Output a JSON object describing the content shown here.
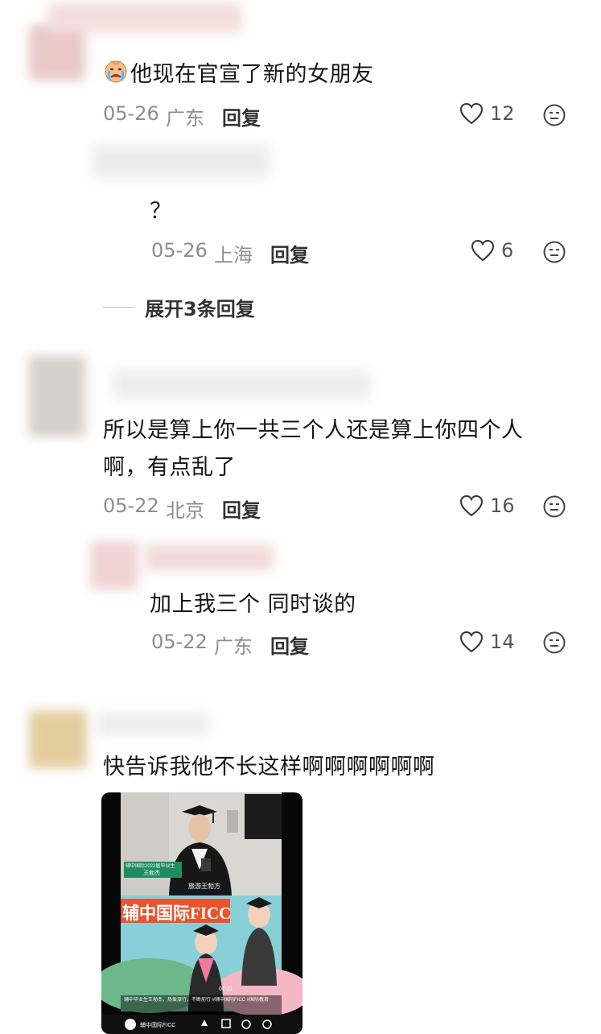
{
  "comments": [
    {
      "text": "他现在官宣了新的女朋友",
      "emoji": "crying-face-icon",
      "date": "05-26",
      "location": "广东",
      "reply_label": "回复",
      "likes": "12"
    },
    {
      "text": "？",
      "date": "05-26",
      "location": "上海",
      "reply_label": "回复",
      "likes": "6"
    },
    {
      "text_line1": "所以是算上你一共三个人还是算上你四个人",
      "text_line2": "啊，有点乱了",
      "date": "05-22",
      "location": "北京",
      "reply_label": "回复",
      "likes": "16"
    },
    {
      "text": "加上我三个 同时谈的",
      "date": "05-22",
      "location": "广东",
      "reply_label": "回复",
      "likes": "14"
    },
    {
      "text": "快告诉我他不长这样啊啊啊啊啊啊"
    }
  ],
  "expand_replies": "展开3条回复",
  "video": {
    "banner_title": "辅中国际FICC",
    "name_tag_line1": "辅中国际2022届毕业生",
    "name_tag_line2": "王勃杰",
    "caption": "旅游王勃方",
    "timestamp": "07:21",
    "footer_desc": "辅中毕业生王勃杰，热爱旅行，不断前行 #辅中国际FICC #国际教育",
    "account_name": "辅中国际FICC"
  },
  "colors": {
    "meta_gray": "#8d8d8d",
    "text_black": "#161616",
    "banner_orange": "#e8542d",
    "video_bg": "#070707"
  }
}
